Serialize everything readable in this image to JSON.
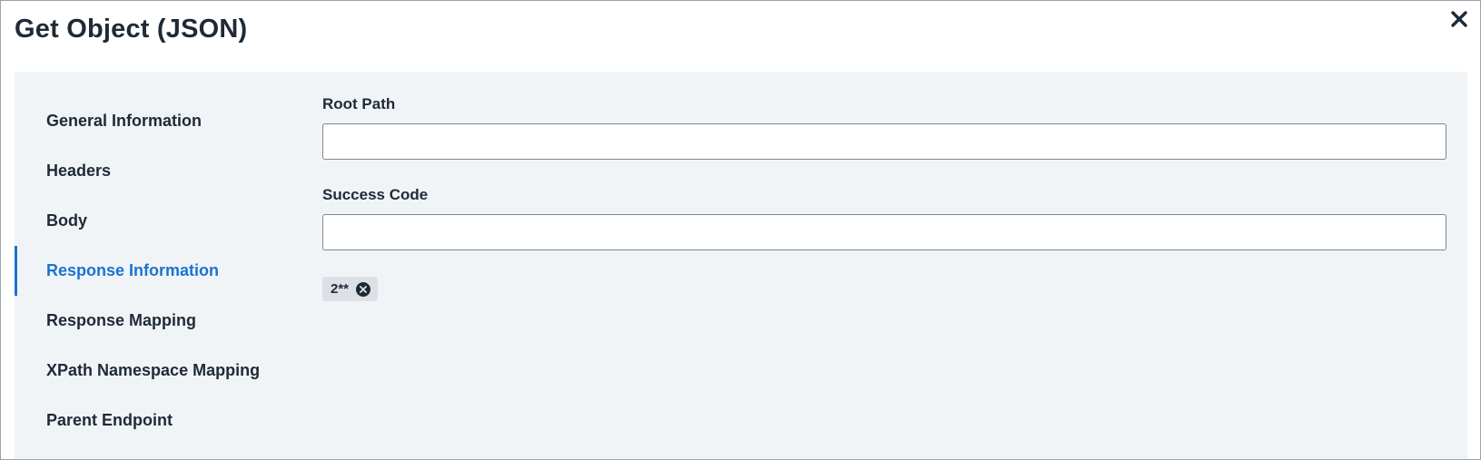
{
  "dialog": {
    "title": "Get Object (JSON)",
    "close_icon": "close-icon"
  },
  "nav": {
    "items": [
      {
        "label": "General Information",
        "active": false
      },
      {
        "label": "Headers",
        "active": false
      },
      {
        "label": "Body",
        "active": false
      },
      {
        "label": "Response Information",
        "active": true
      },
      {
        "label": "Response Mapping",
        "active": false
      },
      {
        "label": "XPath Namespace Mapping",
        "active": false
      },
      {
        "label": "Parent Endpoint",
        "active": false
      }
    ]
  },
  "form": {
    "root_path": {
      "label": "Root Path",
      "value": "",
      "placeholder": ""
    },
    "success_code": {
      "label": "Success Code",
      "value": "",
      "placeholder": "",
      "chips": [
        {
          "label": "2**",
          "remove_icon": "remove-circle-icon"
        }
      ]
    }
  },
  "colors": {
    "accent": "#1a73d1",
    "panel_background": "#f1f4f7",
    "text": "#1f2a37",
    "chip_background": "#dde1e6"
  }
}
